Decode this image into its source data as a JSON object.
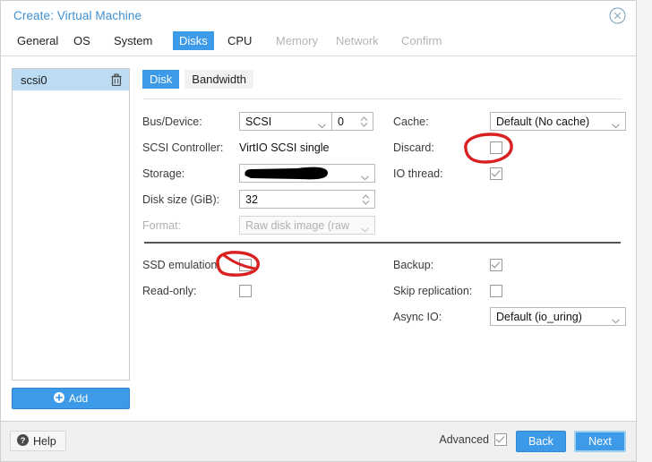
{
  "window": {
    "title": "Create: Virtual Machine",
    "close_icon": "close-circle-icon"
  },
  "wizard_tabs": [
    {
      "label": "General",
      "state": "enabled"
    },
    {
      "label": "OS",
      "state": "enabled"
    },
    {
      "label": "System",
      "state": "enabled"
    },
    {
      "label": "Disks",
      "state": "active"
    },
    {
      "label": "CPU",
      "state": "enabled"
    },
    {
      "label": "Memory",
      "state": "disabled"
    },
    {
      "label": "Network",
      "state": "disabled"
    },
    {
      "label": "Confirm",
      "state": "disabled"
    }
  ],
  "disk_list": {
    "items": [
      {
        "label": "scsi0",
        "selected": true,
        "delete_icon": "trash-icon"
      }
    ],
    "add_button": {
      "label": "Add",
      "icon": "plus-circle-icon"
    }
  },
  "subtabs": [
    {
      "label": "Disk",
      "active": true
    },
    {
      "label": "Bandwidth",
      "active": false
    }
  ],
  "form": {
    "bus_device": {
      "label": "Bus/Device:",
      "bus_value": "SCSI",
      "device_value": "0"
    },
    "scsi_controller": {
      "label": "SCSI Controller:",
      "value": "VirtIO SCSI single"
    },
    "storage": {
      "label": "Storage:",
      "value": "",
      "redacted": true
    },
    "disk_size": {
      "label": "Disk size (GiB):",
      "value": "32"
    },
    "format": {
      "label": "Format:",
      "value": "Raw disk image (raw",
      "disabled": true
    },
    "cache": {
      "label": "Cache:",
      "value": "Default (No cache)"
    },
    "discard": {
      "label": "Discard:",
      "checked": false
    },
    "io_thread": {
      "label": "IO thread:",
      "checked": true
    },
    "ssd_emulation": {
      "label": "SSD emulation:",
      "checked": false
    },
    "read_only": {
      "label": "Read-only:",
      "checked": false
    },
    "backup": {
      "label": "Backup:",
      "checked": true
    },
    "skip_replication": {
      "label": "Skip replication:",
      "checked": false
    },
    "async_io": {
      "label": "Async IO:",
      "value": "Default (io_uring)"
    }
  },
  "footer": {
    "help": {
      "label": "Help",
      "icon": "question-circle-icon"
    },
    "advanced": {
      "label": "Advanced",
      "checked": true
    },
    "back": "Back",
    "next": "Next"
  },
  "annotations": [
    {
      "name": "discard-highlight",
      "shape": "ellipse",
      "color": "#d92121"
    },
    {
      "name": "ssd-emulation-highlight",
      "shape": "ellipse",
      "color": "#d92121"
    }
  ],
  "colors": {
    "accent": "#3c9ae8",
    "title": "#3f8fcf",
    "selection": "#bbdcf2",
    "annotation": "#d92121"
  }
}
